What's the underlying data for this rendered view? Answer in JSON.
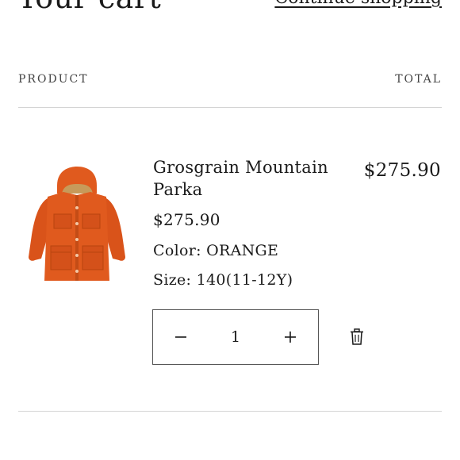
{
  "header": {
    "title": "Your cart",
    "continue_label": "Continue shopping"
  },
  "table": {
    "col_product": "PRODUCT",
    "col_total": "TOTAL"
  },
  "items": [
    {
      "name": "Grosgrain Mountain Parka",
      "unit_price": "$275.90",
      "line_total": "$275.90",
      "color_text": "Color: ORANGE",
      "size_text": "Size: 140(11-12Y)",
      "quantity": "1",
      "image_icon": "orange-parka-image",
      "product_color": "#e05a1e"
    }
  ],
  "icons": {
    "minus": "minus-icon",
    "plus": "plus-icon",
    "remove": "trash-icon"
  }
}
